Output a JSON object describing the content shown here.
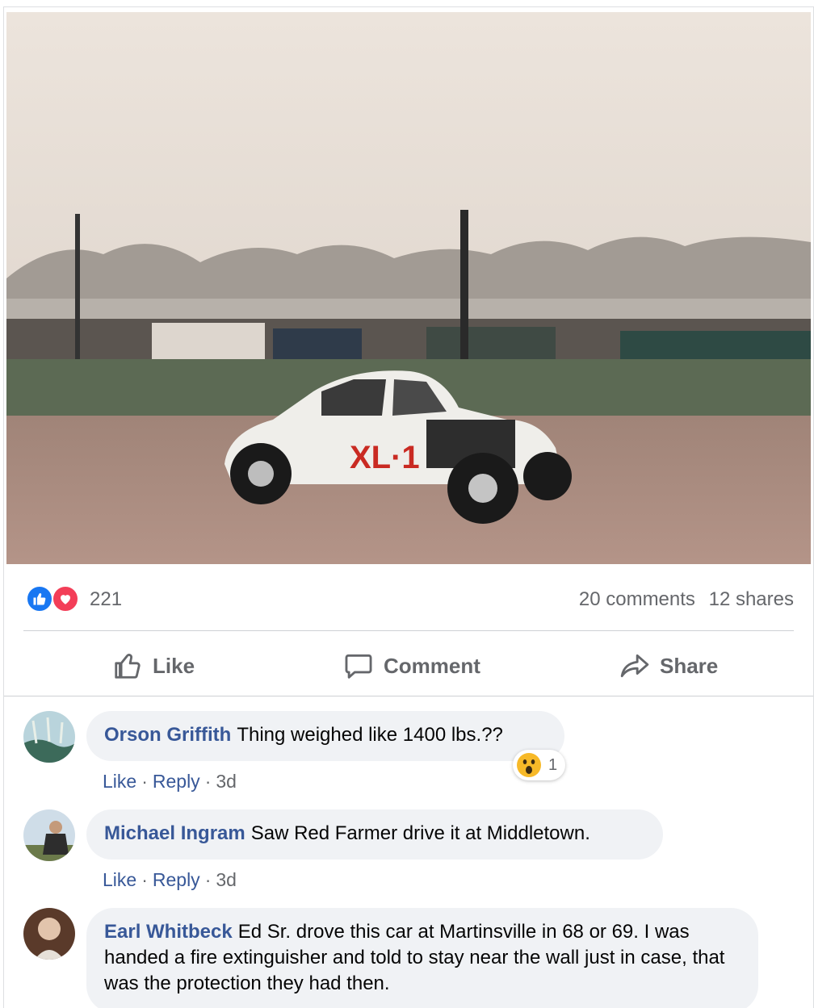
{
  "post": {
    "reactions": {
      "icons": [
        "like-icon",
        "love-icon"
      ],
      "count": "221"
    },
    "comments_count": "20 comments",
    "shares_count": "12 shares",
    "actions": {
      "like": "Like",
      "comment": "Comment",
      "share": "Share"
    }
  },
  "comments": [
    {
      "author": "Orson Griffith",
      "text": "Thing weighed like 1400 lbs.??",
      "like": "Like",
      "reply": "Reply",
      "time": "3d",
      "reaction": {
        "icon": "wow-icon",
        "count": "1"
      }
    },
    {
      "author": "Michael Ingram",
      "text": "Saw Red Farmer drive it at Middletown.",
      "like": "Like",
      "reply": "Reply",
      "time": "3d"
    },
    {
      "author": "Earl Whitbeck",
      "text": "Ed Sr. drove this car at Martinsville in 68 or 69. I was handed a fire extinguisher and told to stay near the wall just in case, that was the protection they had then."
    }
  ],
  "colors": {
    "link": "#385898",
    "muted": "#65676b",
    "bubble": "#f0f2f5",
    "like_blue": "#1877f2",
    "love_red": "#f33e58"
  }
}
